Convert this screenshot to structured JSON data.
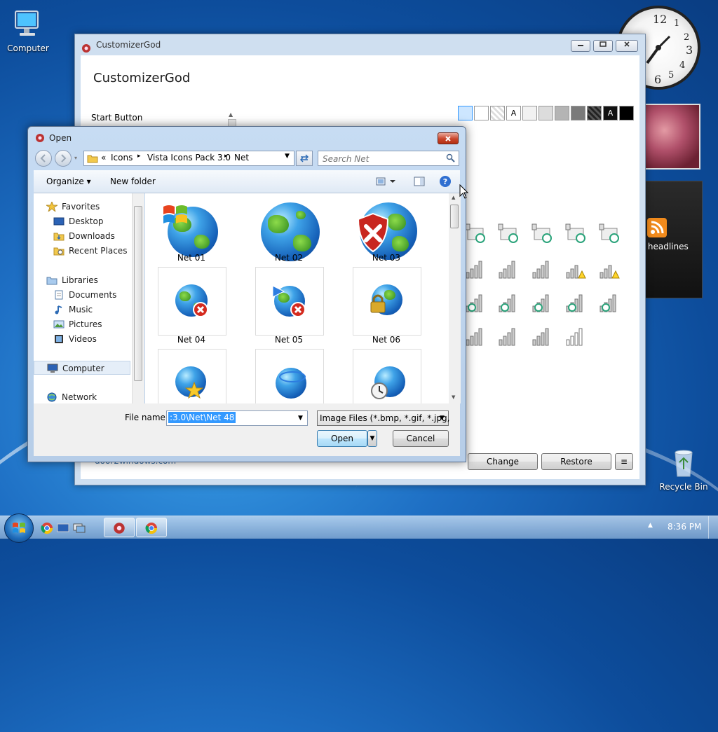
{
  "desktop": {
    "computer_label": "Computer",
    "recycle_label": "Recycle Bin",
    "feed_text": "y headlines"
  },
  "clock_numbers": [
    "12",
    "1",
    "2",
    "3",
    "4",
    "5",
    "6"
  ],
  "main_window": {
    "title": "CustomizerGod",
    "heading": "CustomizerGod",
    "section_label": "Start Button",
    "swatch_a1": "A",
    "swatch_a2": "A",
    "footer_link": "door2windows.com",
    "change_label": "Change",
    "restore_label": "Restore",
    "menu_label": "≡"
  },
  "dialog": {
    "title": "Open",
    "address": {
      "chevron": "«",
      "crumbs": [
        "Icons",
        "Vista Icons Pack 3.0",
        "Net"
      ],
      "sep": "▸"
    },
    "search_placeholder": "Search Net",
    "organize_label": "Organize ▾",
    "new_folder_label": "New folder",
    "nav": {
      "favorites": "Favorites",
      "desktop": "Desktop",
      "downloads": "Downloads",
      "recent": "Recent Places",
      "libraries": "Libraries",
      "documents": "Documents",
      "music": "Music",
      "pictures": "Pictures",
      "videos": "Videos",
      "computer": "Computer",
      "network": "Network"
    },
    "files": [
      "Net 01",
      "Net 02",
      "Net 03",
      "Net 04",
      "Net 05",
      "Net 06"
    ],
    "filename_label": "File name:",
    "filename_value": ":3.0\\Net\\Net 48",
    "filetype_value": "Image Files (*.bmp, *.gif, *.jpg,",
    "open_label": "Open",
    "cancel_label": "Cancel"
  },
  "taskbar": {
    "time": "8:36 PM"
  },
  "colors": {
    "selection_blue": "#3399ff",
    "desktop_blue": "#1e6fc4",
    "close_red": "#c9452b"
  }
}
